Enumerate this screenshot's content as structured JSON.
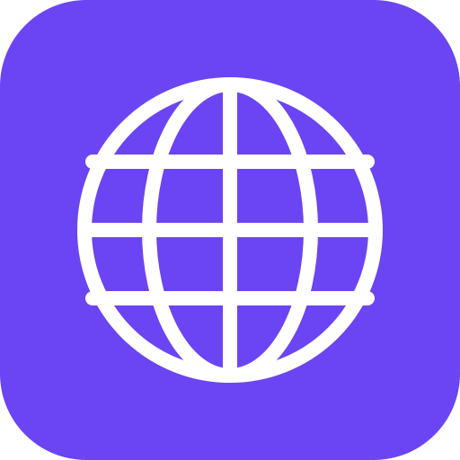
{
  "icon": {
    "name": "globe-icon",
    "background_color": "#6B45F3",
    "glyph_color": "#FFFFFF"
  }
}
